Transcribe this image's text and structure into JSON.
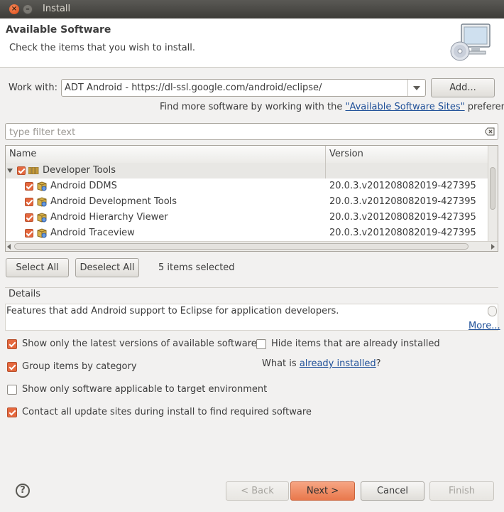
{
  "window": {
    "title": "Install",
    "close_glyph": "×",
    "min_glyph": "–"
  },
  "banner": {
    "title": "Available Software",
    "subtitle": "Check the items that you wish to install.",
    "icon": "install-wizard-monitor-cd-icon"
  },
  "work_with": {
    "label": "Work with:",
    "value": "ADT Android - https://dl-ssl.google.com/android/eclipse/",
    "add_button": "Add...",
    "find_more_prefix": "Find more software by working with the ",
    "find_more_link": "\"Available Software Sites\"",
    "find_more_suffix": " preferences."
  },
  "filter": {
    "placeholder": "type filter text",
    "value": ""
  },
  "table": {
    "col_name": "Name",
    "col_version": "Version",
    "group": {
      "label": "Developer Tools",
      "checked": true,
      "expanded": true
    },
    "items": [
      {
        "name": "Android DDMS",
        "version": "20.0.3.v201208082019-427395",
        "checked": true
      },
      {
        "name": "Android Development Tools",
        "version": "20.0.3.v201208082019-427395",
        "checked": true
      },
      {
        "name": "Android Hierarchy Viewer",
        "version": "20.0.3.v201208082019-427395",
        "checked": true
      },
      {
        "name": "Android Traceview",
        "version": "20.0.3.v201208082019-427395",
        "checked": true
      }
    ]
  },
  "selection": {
    "select_all": "Select All",
    "deselect_all": "Deselect All",
    "status": "5 items selected"
  },
  "details": {
    "label": "Details",
    "text": "Features that add Android support to Eclipse for application developers.",
    "more_link": "More..."
  },
  "options": {
    "latest_versions": {
      "label": "Show only the latest versions of available software",
      "checked": true
    },
    "hide_installed": {
      "label": "Hide items that are already installed",
      "checked": false
    },
    "group_by_category": {
      "label": "Group items by category",
      "checked": true
    },
    "what_is_prefix": "What is ",
    "what_is_link": "already installed",
    "what_is_suffix": "?",
    "target_env": {
      "label": "Show only software applicable to target environment",
      "checked": false
    },
    "contact_sites": {
      "label": "Contact all update sites during install to find required software",
      "checked": true
    }
  },
  "footer": {
    "help_glyph": "?",
    "back": "< Back",
    "next": "Next >",
    "cancel": "Cancel",
    "finish": "Finish"
  },
  "colors": {
    "accent": "#e5683e",
    "link": "#1e4f98",
    "titlebar": "#3d3c38"
  }
}
